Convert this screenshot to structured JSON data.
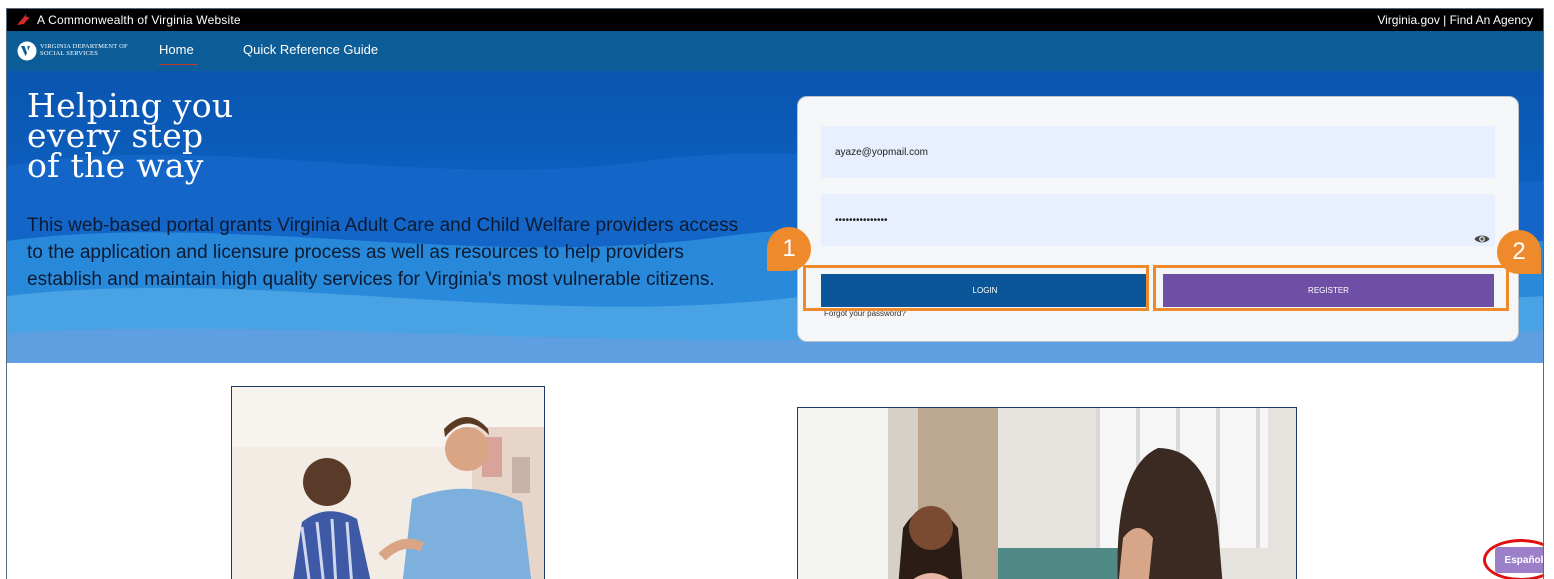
{
  "topbar": {
    "site_label": "A Commonwealth of Virginia Website",
    "links_text": "Virginia.gov | Find An Agency"
  },
  "navbar": {
    "logo_line1": "VIRGINIA DEPARTMENT OF",
    "logo_line2": "SOCIAL SERVICES",
    "items": [
      {
        "label": "Home",
        "active": true
      },
      {
        "label": "Quick Reference Guide",
        "active": false
      }
    ]
  },
  "hero": {
    "title": "Helping you\nevery step\nof the way",
    "description": "This web-based portal grants Virginia Adult Care and Child Welfare providers access to the application and licensure process as well as resources to help providers establish and maintain high quality services for Virginia's most vulnerable citizens."
  },
  "login": {
    "email_value": "ayaze@yopmail.com",
    "password_value": "•••••••••••••••",
    "login_label": "LOGIN",
    "register_label": "REGISTER",
    "forgot_label": "Forgot your password?"
  },
  "annotations": {
    "callout1": "1",
    "callout2": "2",
    "callout_color": "#ef8a2c",
    "ring_color": "#e01010"
  },
  "language_button": "Español",
  "colors": {
    "nav_bg": "#0c5d97",
    "login_button": "#0a5698",
    "register_button": "#6f4fa6",
    "field_bg": "#e8efff"
  }
}
